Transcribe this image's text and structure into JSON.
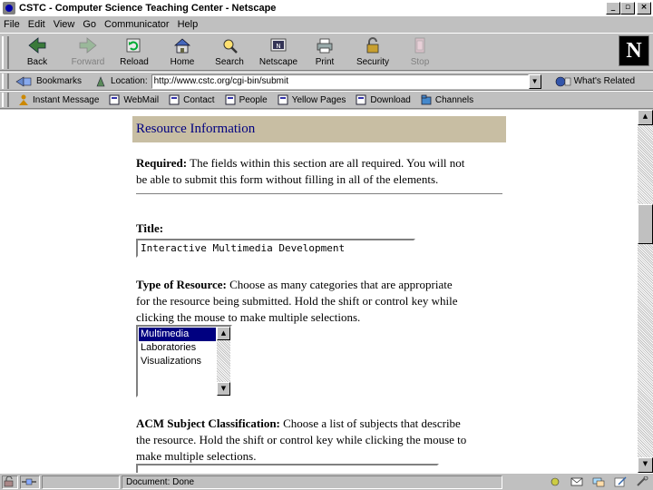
{
  "window": {
    "title": "CSTC - Computer Science Teaching Center - Netscape",
    "controls": {
      "minimize": "_",
      "maximize": "▫",
      "close": "×"
    }
  },
  "menu": [
    "File",
    "Edit",
    "View",
    "Go",
    "Communicator",
    "Help"
  ],
  "toolbar": {
    "back": "Back",
    "forward": "Forward",
    "reload": "Reload",
    "home": "Home",
    "search": "Search",
    "netscape": "Netscape",
    "print": "Print",
    "security": "Security",
    "stop": "Stop",
    "logo": "N"
  },
  "location": {
    "bookmarks_label": "Bookmarks",
    "location_label": "Location:",
    "url": "http://www.cstc.org/cgi-bin/submit",
    "related_label": "What's Related"
  },
  "personal_toolbar": [
    "Instant Message",
    "WebMail",
    "Contact",
    "People",
    "Yellow Pages",
    "Download",
    "Channels"
  ],
  "page": {
    "section_header": "Resource Information",
    "required_bold": "Required:",
    "required_line1": " The fields within this section are all required. You will not",
    "required_line2": "be able to submit this form without filling in all of the elements.",
    "title_label": "Title:",
    "title_value": "Interactive Multimedia Development",
    "type_bold": "Type of Resource:",
    "type_line1": " Choose as many categories that are appropriate",
    "type_line2": "for the resource being submitted. Hold the shift or control key while",
    "type_line3": "clicking the mouse to make multiple selections.",
    "type_options": [
      "Multimedia",
      "Laboratories",
      "Visualizations"
    ],
    "type_selected": "Multimedia",
    "acm_bold": "ACM Subject Classification:",
    "acm_line1": " Choose a list of subjects that describe",
    "acm_line2": "the resource. Hold the shift or control key while clicking the mouse to",
    "acm_line3": "make multiple selections."
  },
  "status": {
    "text": "Document: Done"
  },
  "colors": {
    "chrome": "#c0c0c0",
    "header_band": "#c8bea3",
    "header_text": "#000080",
    "selection": "#000080"
  }
}
